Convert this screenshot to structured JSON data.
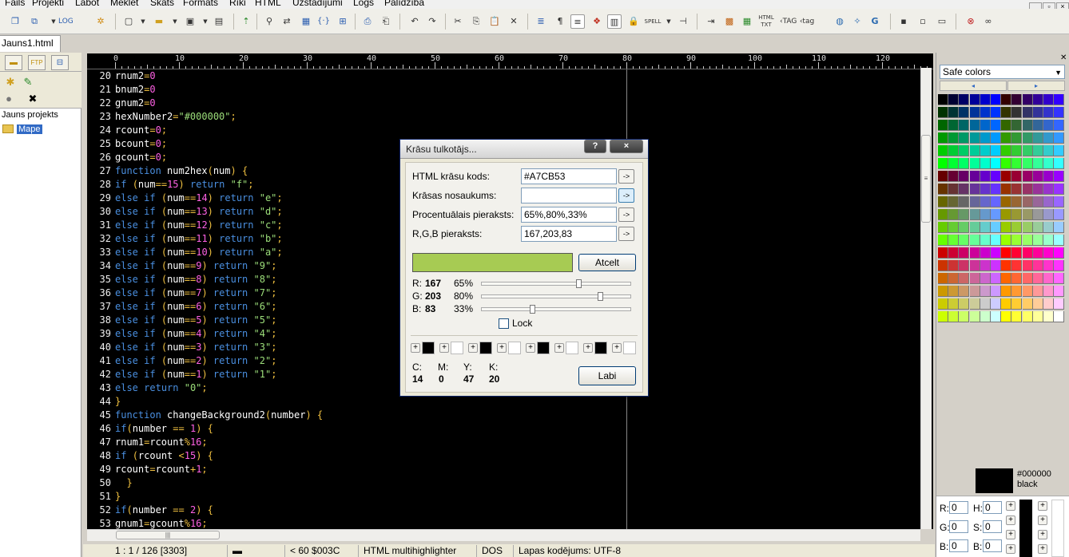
{
  "menu": {
    "items": [
      "Fails",
      "Projekti",
      "Labot",
      "Meklēt",
      "Skats",
      "Formāts",
      "Rīki",
      "HTML",
      "Uzstādījumi",
      "Logs",
      "Palīdzība"
    ]
  },
  "window_controls": [
    "_",
    "▫",
    "×"
  ],
  "toolbar": {
    "icons": [
      "new-icon",
      "open-icon",
      "save-icon",
      "ftp-icon",
      "search-icon",
      "undo-icon",
      "redo-icon",
      "cut-icon",
      "copy-icon",
      "paste-icon",
      "close-icon",
      "spell-icon",
      "color-picker-icon",
      "tag-icon"
    ]
  },
  "tabs": {
    "active": "Jauns1.html"
  },
  "left_panel": {
    "tabs": [
      "folder-icon",
      "ftp-icon",
      "window-icon"
    ],
    "ftp_tab_label": "FTP",
    "project_title": "Jauns projekts",
    "folder_label": "Mape"
  },
  "editor": {
    "ruler_marks": [
      "0",
      "10",
      "20",
      "30",
      "40",
      "50",
      "60",
      "70",
      "80",
      "90",
      "100",
      "110",
      "120"
    ],
    "line_numbers": [
      "20",
      "21",
      "22",
      "23",
      "24",
      "25",
      "26",
      "27",
      "28",
      "29",
      "30",
      "31",
      "32",
      "33",
      "34",
      "35",
      "36",
      "37",
      "38",
      "39",
      "40",
      "41",
      "42",
      "43",
      "44",
      "45",
      "46",
      "47",
      "48",
      "49",
      "50",
      "51",
      "52",
      "53"
    ],
    "code_lines": [
      "rnum2=0",
      "bnum2=0",
      "gnum2=0",
      "hexNumber2=\"#000000\";",
      "rcount=0;",
      "bcount=0;",
      "gcount=0;",
      "function num2hex(num) {",
      "if (num==15) return \"f\";",
      "else if (num==14) return \"e\";",
      "else if (num==13) return \"d\";",
      "else if (num==12) return \"c\";",
      "else if (num==11) return \"b\";",
      "else if (num==10) return \"a\";",
      "else if (num==9) return \"9\";",
      "else if (num==8) return \"8\";",
      "else if (num==7) return \"7\";",
      "else if (num==6) return \"6\";",
      "else if (num==5) return \"5\";",
      "else if (num==4) return \"4\";",
      "else if (num==3) return \"3\";",
      "else if (num==2) return \"2\";",
      "else if (num==1) return \"1\";",
      "else return \"0\";",
      "}",
      "function changeBackground2(number) {",
      "if(number == 1) {",
      "rnum1=rcount%16;",
      "if (rcount <15) {",
      "rcount=rcount+1;",
      "  }",
      "}",
      "if(number == 2) {",
      "gnum1=gcount%16;"
    ]
  },
  "statusbar": {
    "position": "1 : 1 / 126  [3303]",
    "char_info": "<  60  $003C",
    "highlighter": "HTML multihighlighter",
    "line_ending": "DOS",
    "encoding": "Lapas kodējums: UTF-8"
  },
  "dialog": {
    "title": "Krāsu tulkotājs...",
    "help_btn": "?",
    "close_btn": "×",
    "fields": [
      {
        "label": "HTML krāsu kods:",
        "value": "#A7CB53"
      },
      {
        "label": "Krāsas nosaukums:",
        "value": ""
      },
      {
        "label": "Procentuālais pieraksts:",
        "value": "65%,80%,33%"
      },
      {
        "label": "R,G,B pieraksts:",
        "value": "167,203,83"
      }
    ],
    "arrow_label": "->",
    "cancel_label": "Atcelt",
    "ok_label": "Labi",
    "preview_color": "#A7CB53",
    "sliders": [
      {
        "label": "R:",
        "value": "167",
        "percent": "65%",
        "fraction": 0.65
      },
      {
        "label": "G:",
        "value": "203",
        "percent": "80%",
        "fraction": 0.8
      },
      {
        "label": "B:",
        "value": "83",
        "percent": "33%",
        "fraction": 0.33
      }
    ],
    "lock_label": "Lock",
    "cmyk": [
      {
        "label": "C:",
        "value": "14"
      },
      {
        "label": "M:",
        "value": "0"
      },
      {
        "label": "Y:",
        "value": "47"
      },
      {
        "label": "K:",
        "value": "20"
      }
    ]
  },
  "right_panel": {
    "palette_name": "Safe colors",
    "current_hex": "#000000",
    "current_name": "black",
    "rgb": [
      {
        "label": "R:",
        "value": "0"
      },
      {
        "label": "G:",
        "value": "0"
      },
      {
        "label": "B:",
        "value": "0"
      }
    ],
    "hsb": [
      {
        "label": "H:",
        "value": "0"
      },
      {
        "label": "S:",
        "value": "0"
      },
      {
        "label": "B:",
        "value": "0"
      }
    ]
  }
}
